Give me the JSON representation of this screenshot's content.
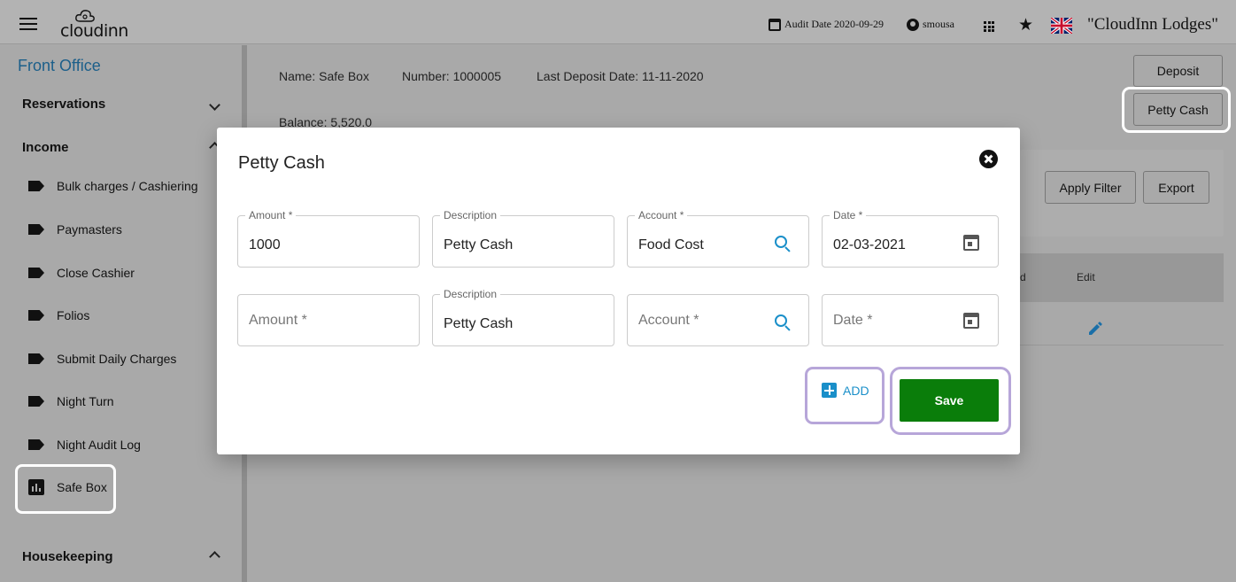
{
  "topbar": {
    "logo_text": "cloudinn",
    "audit_date": "Audit Date 2020-09-29",
    "username": "smousa",
    "hotel_name": "\"CloudInn Lodges\""
  },
  "sidebar": {
    "title": "Front Office",
    "sections": {
      "reservations": "Reservations",
      "income": "Income",
      "housekeeping": "Housekeeping"
    },
    "items": [
      {
        "label": "Bulk charges / Cashiering"
      },
      {
        "label": "Paymasters"
      },
      {
        "label": "Close Cashier"
      },
      {
        "label": "Folios"
      },
      {
        "label": "Submit Daily Charges"
      },
      {
        "label": "Night Turn"
      },
      {
        "label": "Night Audit Log"
      },
      {
        "label": "Safe Box"
      }
    ]
  },
  "main": {
    "name": "Name: Safe Box",
    "number": "Number: 1000005",
    "last_deposit": "Last Deposit Date: 11-11-2020",
    "balance": "Balance: 5,520.0",
    "deposit_button": "Deposit",
    "petty_cash_button": "Petty Cash",
    "apply_filter_button": "Apply Filter",
    "export_button": "Export",
    "table_header_partial": "d",
    "table_header_edit": "Edit"
  },
  "modal": {
    "title": "Petty Cash",
    "rows": [
      {
        "amount_label": "Amount *",
        "amount_value": "1000",
        "description_label": "Description",
        "description_value": "Petty Cash",
        "account_label": "Account *",
        "account_value": "Food Cost",
        "date_label": "Date *",
        "date_value": "02-03-2021"
      },
      {
        "amount_placeholder": "Amount *",
        "description_label": "Description",
        "description_value": "Petty Cash",
        "account_placeholder": "Account *",
        "date_placeholder": "Date *"
      }
    ],
    "add_label": "ADD",
    "save_label": "Save"
  },
  "colors": {
    "accent_blue": "#1a8fc9",
    "save_green": "#0a7d0a",
    "sidebar_title": "#1c5f8a",
    "highlight_purple": "#b7a6d9"
  }
}
